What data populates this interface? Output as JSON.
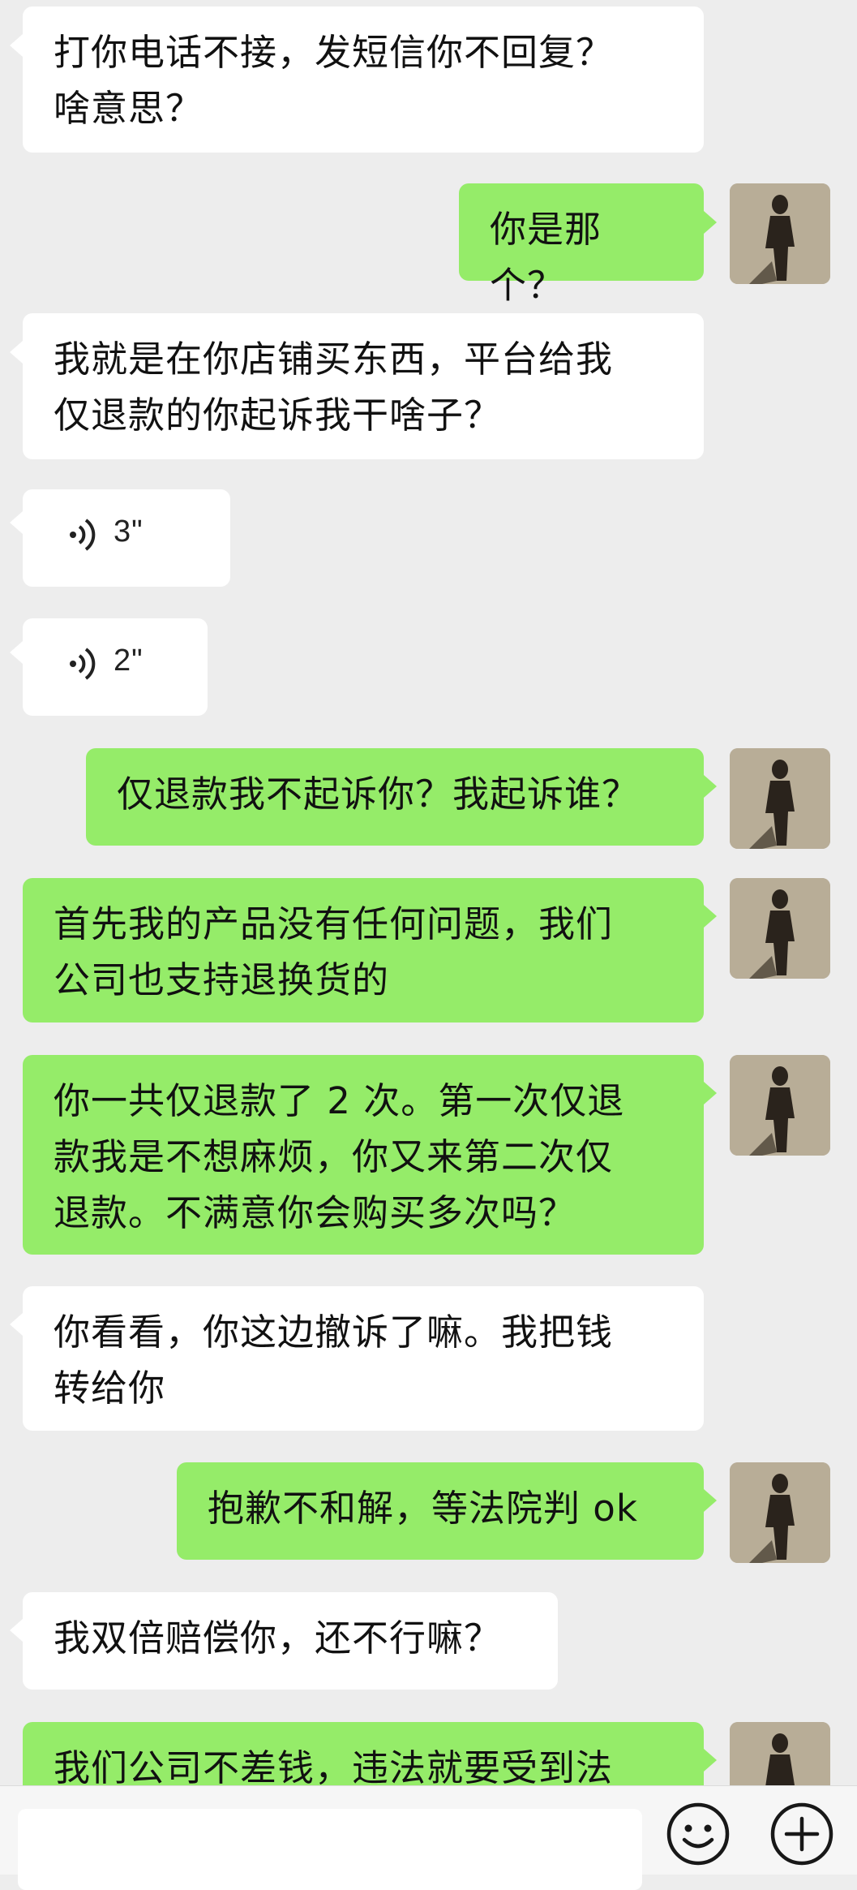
{
  "messages": [
    {
      "side": "in",
      "text": "打你电话不接，发短信你不回复？\n啥意思？"
    },
    {
      "side": "out",
      "text": "你是那个？"
    },
    {
      "side": "in",
      "text": "我就是在你店铺买东西，平台给我\n仅退款的你起诉我干啥子？"
    },
    {
      "side": "in",
      "voice": true,
      "duration": "3\""
    },
    {
      "side": "in",
      "voice": true,
      "duration": "2\""
    },
    {
      "side": "out",
      "text": "仅退款我不起诉你？我起诉谁？"
    },
    {
      "side": "out",
      "text": "首先我的产品没有任何问题，我们\n公司也支持退换货的"
    },
    {
      "side": "out",
      "text": "你一共仅退款了 2 次。第一次仅退\n款我是不想麻烦，你又来第二次仅\n退款。不满意你会购买多次吗？"
    },
    {
      "side": "in",
      "text": "你看看，你这边撤诉了嘛。我把钱\n转给你"
    },
    {
      "side": "out",
      "text": "抱歉不和解，等法院判 ok"
    },
    {
      "side": "in",
      "text": "我双倍赔偿你，还不行嘛？"
    },
    {
      "side": "out",
      "text": "我们公司不差钱，违法就要受到法"
    }
  ],
  "input": {
    "placeholder": ""
  },
  "icons": {
    "emoji": "emoji-icon",
    "more": "plus-icon",
    "voice": "voice-wave-icon",
    "avatar": "avatar-silhouette"
  },
  "colors": {
    "background": "#ededed",
    "incoming": "#ffffff",
    "outgoing": "#95ec69"
  }
}
